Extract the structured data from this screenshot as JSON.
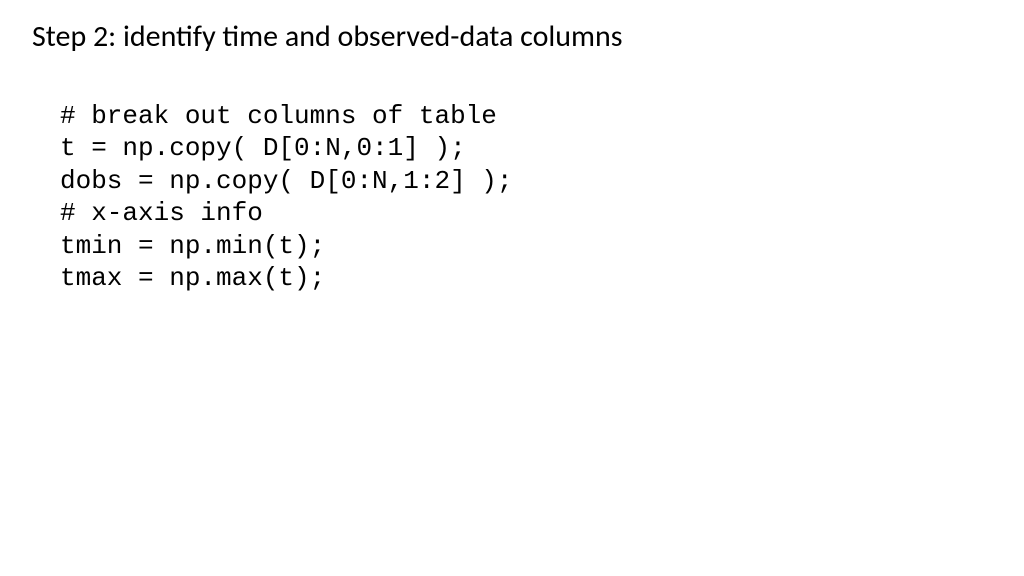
{
  "title": "Step 2: identify time and observed-data columns",
  "code": {
    "line1": "# break out columns of table",
    "line2": "t = np.copy( D[0:N,0:1] );",
    "line3": "dobs = np.copy( D[0:N,1:2] );",
    "line4": "# x-axis info",
    "line5": "tmin = np.min(t);",
    "line6": "tmax = np.max(t);"
  }
}
